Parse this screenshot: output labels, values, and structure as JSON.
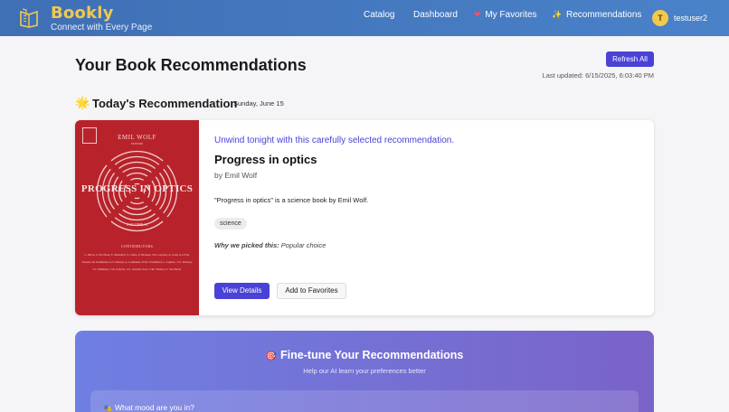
{
  "header": {
    "brand": "Bookly",
    "tagline": "Connect with Every Page",
    "nav": {
      "catalog": "Catalog",
      "dashboard": "Dashboard",
      "favorites": "My Favorites",
      "recommendations": "Recommendations"
    },
    "user": {
      "initial": "T",
      "name": "testuser2"
    }
  },
  "page": {
    "title": "Your Book Recommendations",
    "refresh_label": "Refresh All",
    "last_updated": "Last updated: 6/15/2025, 6:03:40 PM"
  },
  "today": {
    "heading": "Today's Recommendation",
    "date": "Sunday, June 15",
    "tagline": "Unwind tonight with this carefully selected recommendation.",
    "book": {
      "title": "Progress in optics",
      "author": "by Emil Wolf",
      "description": "\"Progress in optics\" is a science book by Emil Wolf.",
      "tag": "science",
      "why_label": "Why we picked this:",
      "why_value": "Popular choice"
    },
    "cover": {
      "author": "EMIL WOLF",
      "editor": "EDITOR",
      "title": "PROGRESS IN OPTICS",
      "volume": "VOLUME 11",
      "contributors_label": "CONTRIBUTORS",
      "contributors": "C. Birch, J.J.M. Braat, E. Brundrett, S. Curtis, P. Dickens, T.K. Gaylord, A. Gatti, A.J.E.M. Janssen, M. Kaufmann, A.S. Khoury, A. Lakhtakia, N.M. Litchinitser, L. Lugiato, T.G. Mackay, S.J. Mulshine, C.R. Pollock, L.E. Sanchez-Soto, V.M. Shalaev, S. Van Haver"
    },
    "details_label": "View Details",
    "favorite_label": "Add to Favorites"
  },
  "tune": {
    "title": "Fine-tune Your Recommendations",
    "subtitle": "Help our AI learn your preferences better",
    "mood_label": "What mood are you in?"
  },
  "colors": {
    "header": "#4a7cc2",
    "brand": "#f2c94c",
    "accent": "#4a42d6",
    "cover": "#b8232b"
  }
}
